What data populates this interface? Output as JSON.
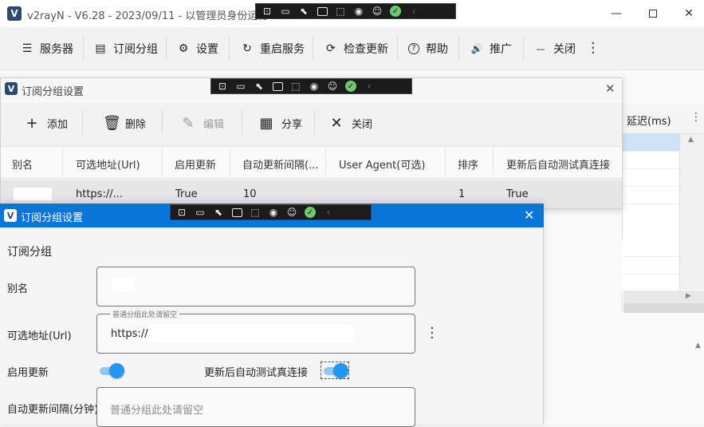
{
  "main": {
    "title": "v2rayN - V6.28 - 2023/09/11 - 以管理员身份运行",
    "logo": "V",
    "menu": [
      {
        "label": "服务器",
        "icon": "☰"
      },
      {
        "label": "订阅分组",
        "icon": "▤"
      },
      {
        "label": "设置",
        "icon": "⚙"
      },
      {
        "label": "重启服务",
        "icon": "↻"
      },
      {
        "label": "检查更新",
        "icon": "⟳"
      },
      {
        "label": "帮助",
        "icon": "?"
      },
      {
        "label": "推广",
        "icon": "🔊"
      },
      {
        "label": "关闭",
        "icon": "—"
      }
    ],
    "grid_header": "延迟(ms)"
  },
  "sub_list": {
    "title": "订阅分组设置",
    "toolbar": {
      "add": "添加",
      "delete": "删除",
      "edit": "编辑",
      "share": "分享",
      "close": "关闭"
    },
    "columns": [
      "别名",
      "可选地址(Url)",
      "启用更新",
      "自动更新间隔(...",
      "User Agent(可选)",
      "排序",
      "更新后自动测试真连接"
    ],
    "rows": [
      {
        "remarks": "",
        "url": "https://...",
        "enabled": "True",
        "interval": "10",
        "user_agent": "",
        "sort": "1",
        "auto_test": "True"
      }
    ]
  },
  "sub_edit": {
    "title": "订阅分组设置",
    "section": "订阅分组",
    "remarks_label": "别名",
    "url_label": "可选地址(Url)",
    "url_hint": "普通分组此处请留空",
    "url_value": "https://",
    "enable_label": "启用更新",
    "auto_test_label": "更新后自动测试真连接",
    "interval_label": "自动更新间隔(分钟)",
    "interval_placeholder": "普通分组此处请留空",
    "enable_on": true,
    "auto_test_on": true
  },
  "colors": {
    "accent": "#0a74d8",
    "toggle": "#2196f3"
  }
}
